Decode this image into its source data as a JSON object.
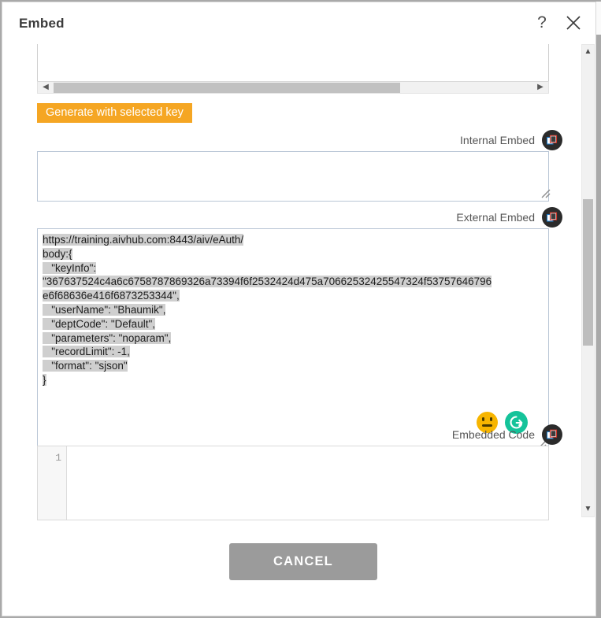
{
  "dialog": {
    "title": "Embed",
    "help_icon": "?",
    "close_icon": "close-icon"
  },
  "toolbar": {
    "generate_label": "Generate with selected key"
  },
  "fields": {
    "internal_embed": {
      "label": "Internal Embed",
      "value": "",
      "copy_icon": "copy-icon"
    },
    "external_embed": {
      "label": "External Embed",
      "copy_icon": "copy-icon",
      "lines": [
        "https://training.aivhub.com:8443/aiv/eAuth/",
        "body:{",
        "   \"keyInfo\":",
        "\"367637524c4a6c6758787869326a73394f6f2532424d475a70662532425547324f53757646796",
        "e6f68636e416f6873253344\",",
        "   \"userName\": \"Bhaumik\",",
        "   \"deptCode\": \"Default\",",
        "   \"parameters\": \"noparam\",",
        "   \"recordLimit\": -1,",
        "   \"format\": \"sjson\"",
        "}"
      ]
    },
    "embedded_code": {
      "label": "Embedded Code",
      "copy_icon": "copy-icon",
      "line_number": "1",
      "value": ""
    }
  },
  "grammarly": {
    "status_icon": "neutral-face-icon",
    "logo_icon": "grammarly-logo-icon"
  },
  "actions": {
    "cancel_label": "CANCEL"
  },
  "scrollbars": {
    "left_arrow": "◀",
    "right_arrow": "▶",
    "up_arrow": "▲",
    "down_arrow": "▼"
  },
  "colors": {
    "accent_orange": "#f5a623",
    "cancel_grey": "#9b9b9b",
    "grammarly_green": "#15c39a",
    "status_yellow": "#f7b500",
    "selection_grey": "#cfcfcf"
  }
}
